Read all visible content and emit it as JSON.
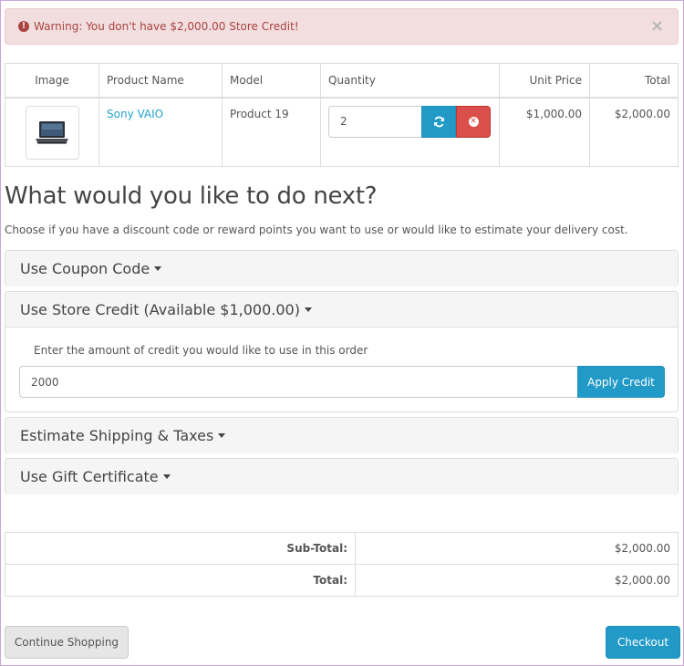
{
  "alert": {
    "icon": "exclamation-circle-icon",
    "message": "Warning: You don't have $2,000.00 Store Credit!",
    "close_glyph": "×"
  },
  "cart": {
    "headers": {
      "image": "Image",
      "name": "Product Name",
      "model": "Model",
      "quantity": "Quantity",
      "unit_price": "Unit Price",
      "total": "Total"
    },
    "rows": [
      {
        "name": "Sony VAIO",
        "model": "Product 19",
        "quantity": "2",
        "unit_price": "$1,000.00",
        "total": "$2,000.00"
      }
    ]
  },
  "next": {
    "heading": "What would you like to do next?",
    "intro": "Choose if you have a discount code or reward points you want to use or would like to estimate your delivery cost."
  },
  "panels": {
    "coupon": "Use Coupon Code",
    "store_credit": "Use Store Credit (Available $1,000.00)",
    "credit_label": "Enter the amount of credit you would like to use in this order",
    "credit_value": "2000",
    "apply_label": "Apply Credit",
    "shipping": "Estimate Shipping & Taxes",
    "gift": "Use Gift Certificate"
  },
  "totals": [
    {
      "label": "Sub-Total:",
      "value": "$2,000.00"
    },
    {
      "label": "Total:",
      "value": "$2,000.00"
    }
  ],
  "actions": {
    "continue": "Continue Shopping",
    "checkout": "Checkout"
  },
  "colors": {
    "primary": "#229ac8",
    "danger": "#da4f49",
    "alert_bg": "#f2dede",
    "alert_text": "#a94442",
    "link": "#23a1d1"
  }
}
